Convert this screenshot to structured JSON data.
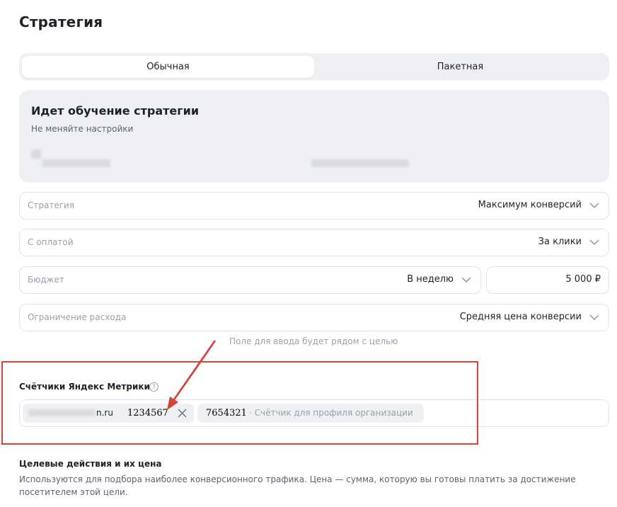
{
  "page": {
    "title": "Стратегия"
  },
  "tabs": [
    {
      "label": "Обычная",
      "active": true
    },
    {
      "label": "Пакетная",
      "active": false
    }
  ],
  "learning": {
    "title": "Идет обучение стратегии",
    "subtitle": "Не меняйте настройки"
  },
  "fields": {
    "strategy": {
      "label": "Стратегия",
      "value": "Максимум конверсий"
    },
    "payment": {
      "label": "С оплатой",
      "value": "За клики"
    },
    "budget": {
      "label": "Бюджет",
      "period": "В неделю",
      "amount": "5 000 ₽"
    },
    "limit": {
      "label": "Ограничение расхода",
      "value": "Средняя цена конверсии"
    }
  },
  "hint": "Поле для ввода будет рядом с целью",
  "metrika": {
    "label": "Счётчики Яндекс Метрики",
    "help_icon": "question-circle-icon",
    "counter1_domain": "n.ru",
    "counter1_id": "1234567",
    "counter2_id": "7654321",
    "counter2_desc": "· Счётчик для профиля организации"
  },
  "goals": {
    "title": "Целевые действия и их цена",
    "description": "Используются для подбора наиболее конверсионного трафика. Цена — сумма, которую вы готовы платить за достижение посетителем этой цели."
  },
  "colors": {
    "highlight": "#d0463b",
    "panel": "#eef0f4"
  }
}
